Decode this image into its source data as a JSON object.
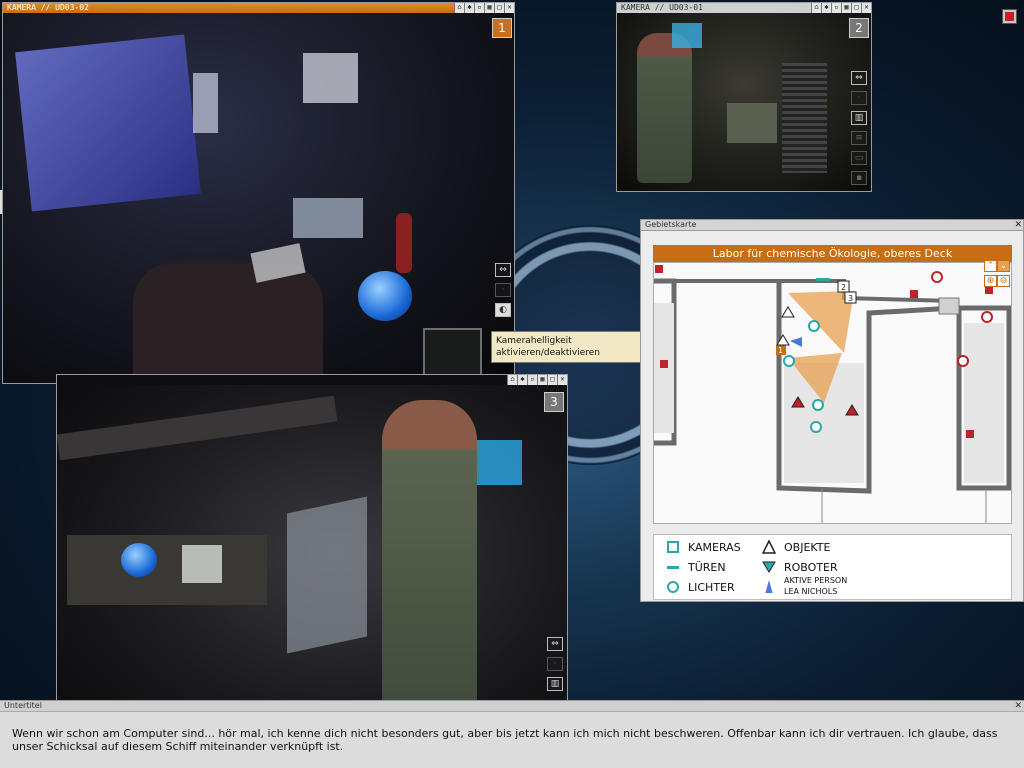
{
  "cameras": [
    {
      "title": "KAMERA // UD03-02",
      "number": "1",
      "active": true
    },
    {
      "title": "KAMERA // UD03-01",
      "number": "2",
      "active": false
    },
    {
      "title": "",
      "number": "3",
      "active": false
    }
  ],
  "tooltip": {
    "line1": "Kamerahelligkeit",
    "line2": "aktivieren/deaktivieren"
  },
  "map": {
    "window_title": "Gebietskarte",
    "header": "Labor für chemische Ökologie, oberes Deck",
    "markers": {
      "cam1": "1",
      "cam2": "2",
      "cam3": "3"
    },
    "legend": {
      "cameras": "KAMERAS",
      "doors": "TÜREN",
      "lights": "LICHTER",
      "objects": "OBJEKTE",
      "robots": "ROBOTER",
      "active_person_line1": "AKTIVE PERSON",
      "active_person_line2": "LEA NICHOLS"
    }
  },
  "subtitles": {
    "window_title": "Untertitel",
    "text": "Wenn wir schon am Computer sind... hör mal, ich kenne dich nicht besonders gut, aber bis jetzt kann ich mich nicht beschweren. Offenbar kann ich dir vertrauen. Ich glaube, dass unser Schicksal auf diesem Schiff miteinander verknüpft ist."
  },
  "colors": {
    "accent": "#c86d12",
    "window_bg": "#ececec",
    "light_marker": "#c0222a",
    "camera_marker": "#2aa8a8"
  }
}
